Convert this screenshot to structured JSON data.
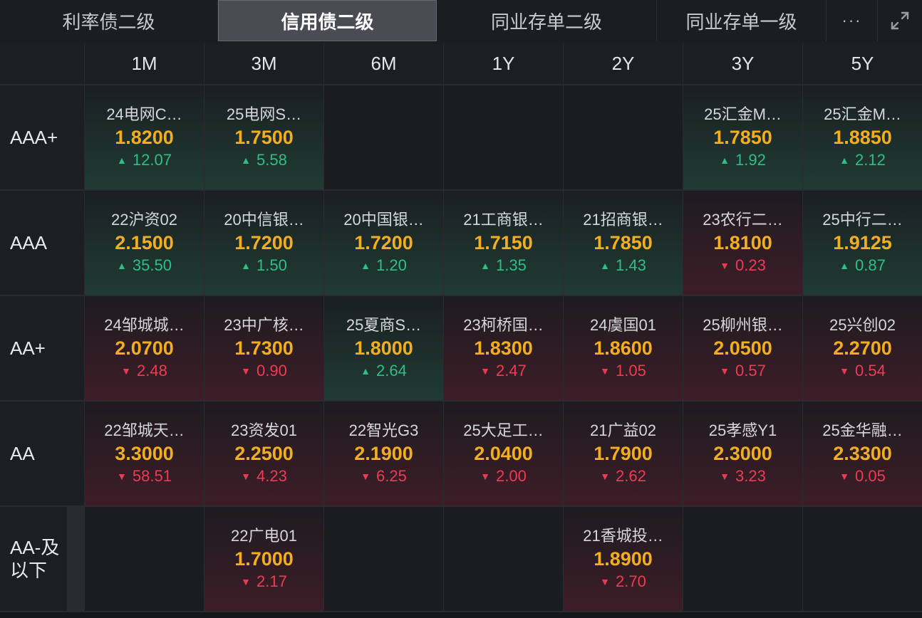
{
  "tabs": [
    {
      "label": "利率债二级",
      "width": 306
    },
    {
      "label": "信用债二级",
      "width": 307,
      "active": true
    },
    {
      "label": "同业存单二级",
      "width": 309
    },
    {
      "label": "同业存单一级",
      "width": 238
    }
  ],
  "more_label": "···",
  "columns": [
    "1M",
    "3M",
    "6M",
    "1Y",
    "2Y",
    "3Y",
    "5Y"
  ],
  "rows": [
    {
      "label": "AAA+",
      "cells": [
        {
          "name": "24电网C…",
          "rate": "1.8200",
          "dir": "up",
          "change": "12.07"
        },
        {
          "name": "25电网S…",
          "rate": "1.7500",
          "dir": "up",
          "change": "5.58"
        },
        null,
        null,
        null,
        {
          "name": "25汇金M…",
          "rate": "1.7850",
          "dir": "up",
          "change": "1.92"
        },
        {
          "name": "25汇金M…",
          "rate": "1.8850",
          "dir": "up",
          "change": "2.12"
        }
      ]
    },
    {
      "label": "AAA",
      "cells": [
        {
          "name": "22沪资02",
          "rate": "2.1500",
          "dir": "up",
          "change": "35.50"
        },
        {
          "name": "20中信银…",
          "rate": "1.7200",
          "dir": "up",
          "change": "1.50"
        },
        {
          "name": "20中国银…",
          "rate": "1.7200",
          "dir": "up",
          "change": "1.20"
        },
        {
          "name": "21工商银…",
          "rate": "1.7150",
          "dir": "up",
          "change": "1.35"
        },
        {
          "name": "21招商银…",
          "rate": "1.7850",
          "dir": "up",
          "change": "1.43"
        },
        {
          "name": "23农行二…",
          "rate": "1.8100",
          "dir": "down",
          "change": "0.23"
        },
        {
          "name": "25中行二…",
          "rate": "1.9125",
          "dir": "up",
          "change": "0.87"
        }
      ]
    },
    {
      "label": "AA+",
      "cells": [
        {
          "name": "24邹城城…",
          "rate": "2.0700",
          "dir": "down",
          "change": "2.48"
        },
        {
          "name": "23中广核…",
          "rate": "1.7300",
          "dir": "down",
          "change": "0.90"
        },
        {
          "name": "25夏商S…",
          "rate": "1.8000",
          "dir": "up",
          "change": "2.64"
        },
        {
          "name": "23柯桥国…",
          "rate": "1.8300",
          "dir": "down",
          "change": "2.47"
        },
        {
          "name": "24虞国01",
          "rate": "1.8600",
          "dir": "down",
          "change": "1.05"
        },
        {
          "name": "25柳州银…",
          "rate": "2.0500",
          "dir": "down",
          "change": "0.57"
        },
        {
          "name": "25兴创02",
          "rate": "2.2700",
          "dir": "down",
          "change": "0.54"
        }
      ]
    },
    {
      "label": "AA",
      "cells": [
        {
          "name": "22邹城天…",
          "rate": "3.3000",
          "dir": "down",
          "change": "58.51"
        },
        {
          "name": "23资发01",
          "rate": "2.2500",
          "dir": "down",
          "change": "4.23"
        },
        {
          "name": "22智光G3",
          "rate": "2.1900",
          "dir": "down",
          "change": "6.25"
        },
        {
          "name": "25大足工…",
          "rate": "2.0400",
          "dir": "down",
          "change": "2.00"
        },
        {
          "name": "21广益02",
          "rate": "1.7900",
          "dir": "down",
          "change": "2.62"
        },
        {
          "name": "25孝感Y1",
          "rate": "2.3000",
          "dir": "down",
          "change": "3.23"
        },
        {
          "name": "25金华融…",
          "rate": "2.3300",
          "dir": "down",
          "change": "0.05"
        }
      ]
    },
    {
      "label": "AA-及以下",
      "cells": [
        null,
        {
          "name": "22广电01",
          "rate": "1.7000",
          "dir": "down",
          "change": "2.17"
        },
        null,
        null,
        {
          "name": "21香城投…",
          "rate": "1.8900",
          "dir": "down",
          "change": "2.70"
        },
        null,
        null
      ]
    }
  ],
  "colors": {
    "up": "#2fbf85",
    "down": "#ee3b53",
    "rate": "#f2ae22",
    "background": "#16171b"
  },
  "icons": {
    "up": "triangle-up-icon",
    "down": "triangle-down-icon",
    "expand": "expand-icon"
  }
}
